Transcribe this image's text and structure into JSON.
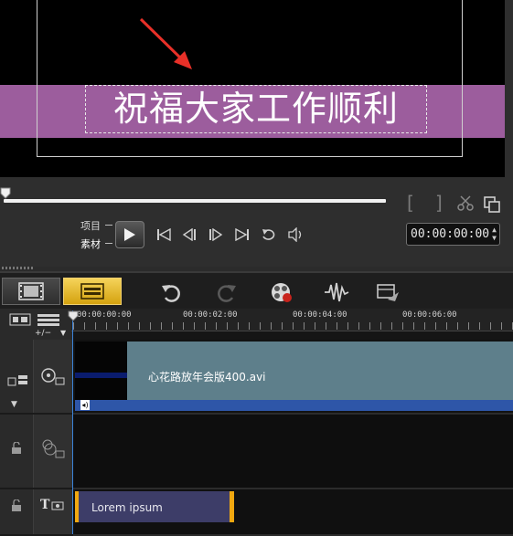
{
  "preview": {
    "title_text": "祝福大家工作顺利",
    "mode_project": "项目",
    "mode_clip": "素材",
    "timecode": "00:00:00:00",
    "mark_in": "[",
    "mark_out": "]"
  },
  "toolbar": {
    "tabs": [
      "storyboard-view",
      "timeline-view"
    ],
    "icons": [
      "undo-icon",
      "redo-icon",
      "record-capture-icon",
      "sound-mixer-icon",
      "auto-music-icon"
    ]
  },
  "timeline": {
    "zoom_control": "+/−",
    "ruler_labels": [
      "00:00:00:00",
      "00:00:02:00",
      "00:00:04:00",
      "00:00:06:00"
    ],
    "video_clip_name": "心花路放年会版400.avi",
    "title_clip_text": "Lorem ipsum",
    "title_track_label": "T"
  },
  "colors": {
    "title_band": "#9c5d9d",
    "video_clip": "#5e7f8b",
    "audio_bar": "#2e56a8",
    "title_clip": "#3d3d68",
    "title_clip_edge": "#f0a810",
    "active_tab": "#e8b830",
    "arrow": "#e83028"
  }
}
